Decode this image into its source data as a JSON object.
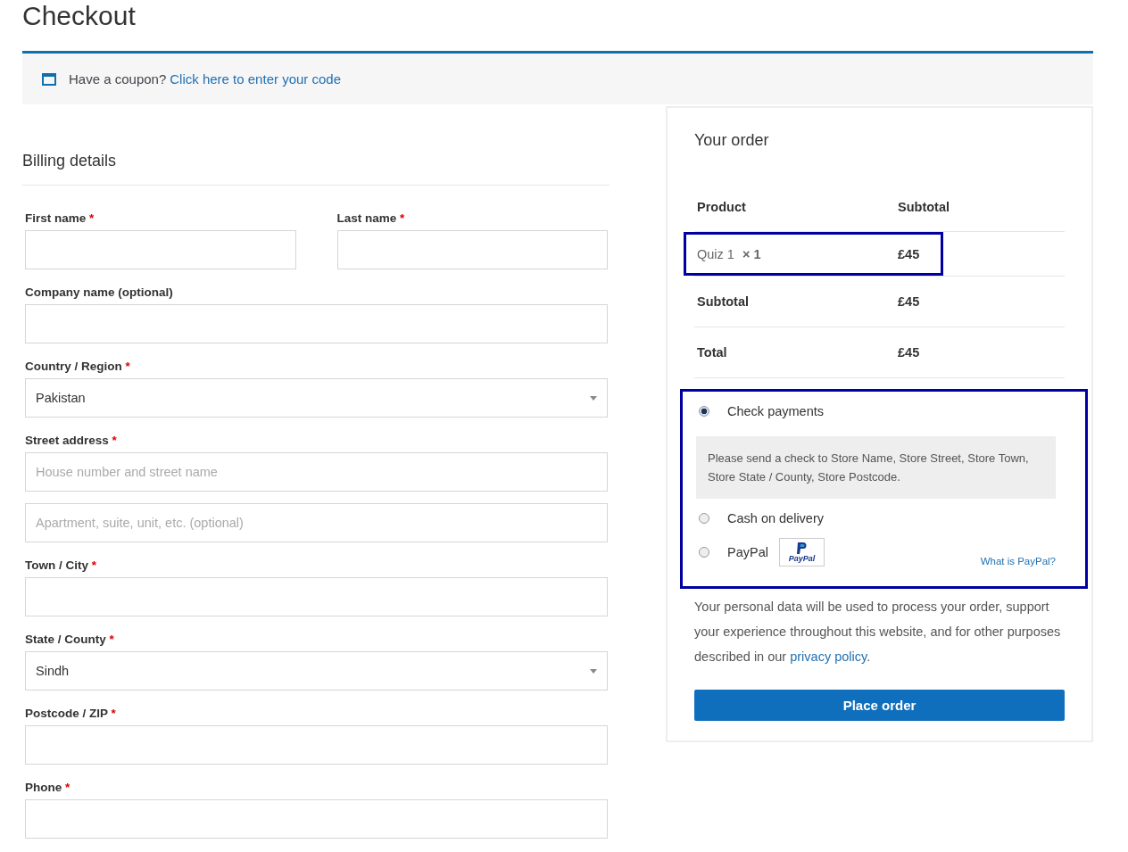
{
  "page_title": "Checkout",
  "coupon": {
    "text": "Have a coupon?",
    "link": "Click here to enter your code"
  },
  "billing": {
    "title": "Billing details",
    "required_mark": "*",
    "rows": [
      [
        {
          "kind": "text",
          "label": "First name",
          "required": true
        },
        {
          "kind": "text",
          "label": "Last name",
          "required": true
        }
      ],
      [
        {
          "kind": "text",
          "label": "Company name (optional)",
          "required": false
        }
      ],
      [
        {
          "kind": "select",
          "label": "Country / Region",
          "required": true,
          "value": "Pakistan"
        }
      ],
      [
        {
          "kind": "text",
          "label": "Street address",
          "required": true,
          "placeholders": [
            "House number and street name",
            "Apartment, suite, unit, etc. (optional)"
          ]
        }
      ],
      [
        {
          "kind": "text",
          "label": "Town / City",
          "required": true
        }
      ],
      [
        {
          "kind": "select",
          "label": "State / County",
          "required": true,
          "value": "Sindh"
        }
      ],
      [
        {
          "kind": "text",
          "label": "Postcode / ZIP",
          "required": true
        }
      ],
      [
        {
          "kind": "text",
          "label": "Phone",
          "required": true
        }
      ]
    ]
  },
  "order": {
    "title": "Your order",
    "columns": [
      "Product",
      "Subtotal"
    ],
    "items": [
      {
        "name": "Quiz 1",
        "quantity": "× 1",
        "total": "£45",
        "highlighted": true
      }
    ],
    "totals": [
      {
        "label": "Subtotal",
        "value": "£45"
      },
      {
        "label": "Total",
        "value": "£45"
      }
    ],
    "payment": {
      "highlighted": true,
      "methods": [
        {
          "kind": "plain",
          "label": "Check payments",
          "selected": true,
          "description": "Please send a check to Store Name, Store Street, Store Town, Store State / County, Store Postcode."
        },
        {
          "kind": "plain",
          "label": "Cash on delivery",
          "selected": false
        },
        {
          "kind": "paypal",
          "label": "PayPal",
          "selected": false,
          "logo_text": "PayPal",
          "link": "What is PayPal?"
        }
      ]
    },
    "privacy": {
      "text": "Your personal data will be used to process your order, support your experience throughout this website, and for other purposes described in our ",
      "link": "privacy policy",
      "after": "."
    },
    "button": "Place order"
  }
}
